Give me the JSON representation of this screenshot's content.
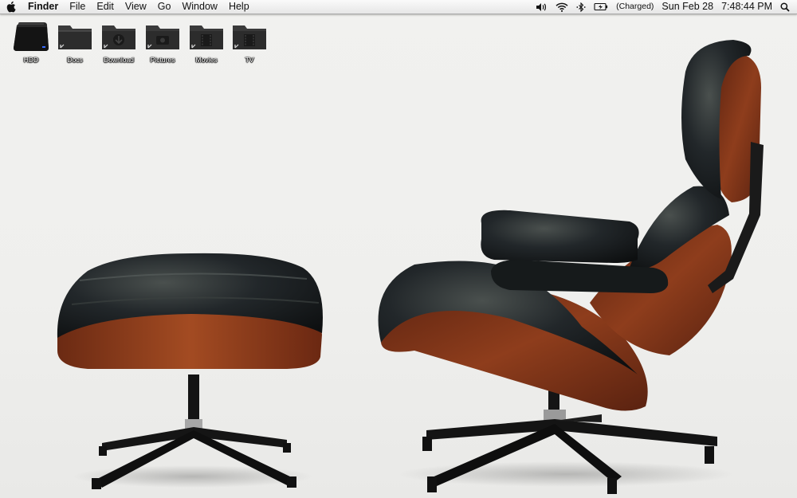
{
  "menubar": {
    "app_name": "Finder",
    "menus": [
      "File",
      "Edit",
      "View",
      "Go",
      "Window",
      "Help"
    ],
    "status": {
      "battery_text": "(Charged)",
      "date": "Sun Feb 28",
      "time": "7:48:44 PM"
    },
    "icons": [
      "apple-icon",
      "volume-icon",
      "wifi-icon",
      "bluetooth-icon",
      "battery-icon",
      "spotlight-icon"
    ]
  },
  "desktop": {
    "icons": [
      {
        "label": "HDD",
        "icon": "hard-drive-icon"
      },
      {
        "label": "Docs",
        "icon": "folder-icon"
      },
      {
        "label": "Download",
        "icon": "downloads-folder-icon"
      },
      {
        "label": "Pictures",
        "icon": "pictures-folder-icon"
      },
      {
        "label": "Movies",
        "icon": "movies-folder-icon"
      },
      {
        "label": "TV",
        "icon": "tv-folder-icon"
      }
    ]
  },
  "wallpaper": {
    "subject": "Lounge chair and ottoman",
    "colors": {
      "wood": "#7a3318",
      "leather": "#1c1f1e",
      "metal": "#1a1a1a",
      "backdrop": "#efefed"
    }
  }
}
